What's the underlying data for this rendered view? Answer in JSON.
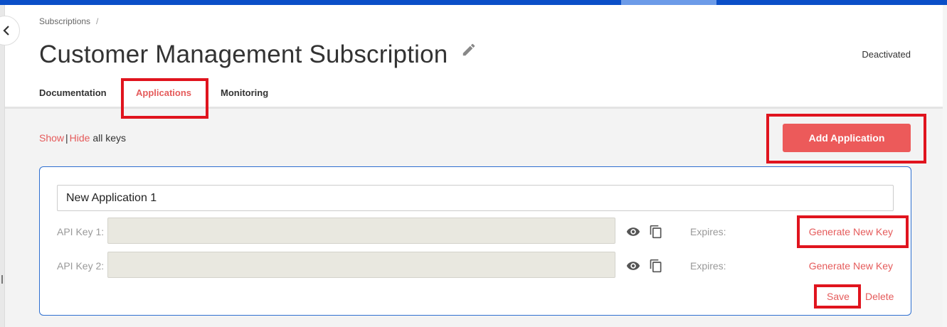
{
  "breadcrumb": {
    "item": "Subscriptions",
    "separator": "/"
  },
  "page": {
    "title": "Customer Management Subscription",
    "status": "Deactivated"
  },
  "tabs": [
    {
      "label": "Documentation",
      "active": false
    },
    {
      "label": "Applications",
      "active": true
    },
    {
      "label": "Monitoring",
      "active": false
    }
  ],
  "keys_toggle": {
    "show": "Show",
    "separator": "|",
    "hide": "Hide",
    "suffix": "all keys"
  },
  "actions": {
    "add_application": "Add Application"
  },
  "application": {
    "name": "New Application 1",
    "keys": [
      {
        "label": "API Key 1:",
        "value": "",
        "expires_label": "Expires:",
        "generate": "Generate New Key"
      },
      {
        "label": "API Key 2:",
        "value": "",
        "expires_label": "Expires:",
        "generate": "Generate New Key"
      }
    ],
    "save": "Save",
    "delete": "Delete"
  },
  "colors": {
    "accent": "#e55b5b",
    "topbar": "#0b4fc8",
    "card_border": "#2e6fd0",
    "highlight": "#e0141e"
  },
  "icons": [
    "chevron-left-icon",
    "pencil-icon",
    "eye-icon",
    "copy-icon"
  ]
}
